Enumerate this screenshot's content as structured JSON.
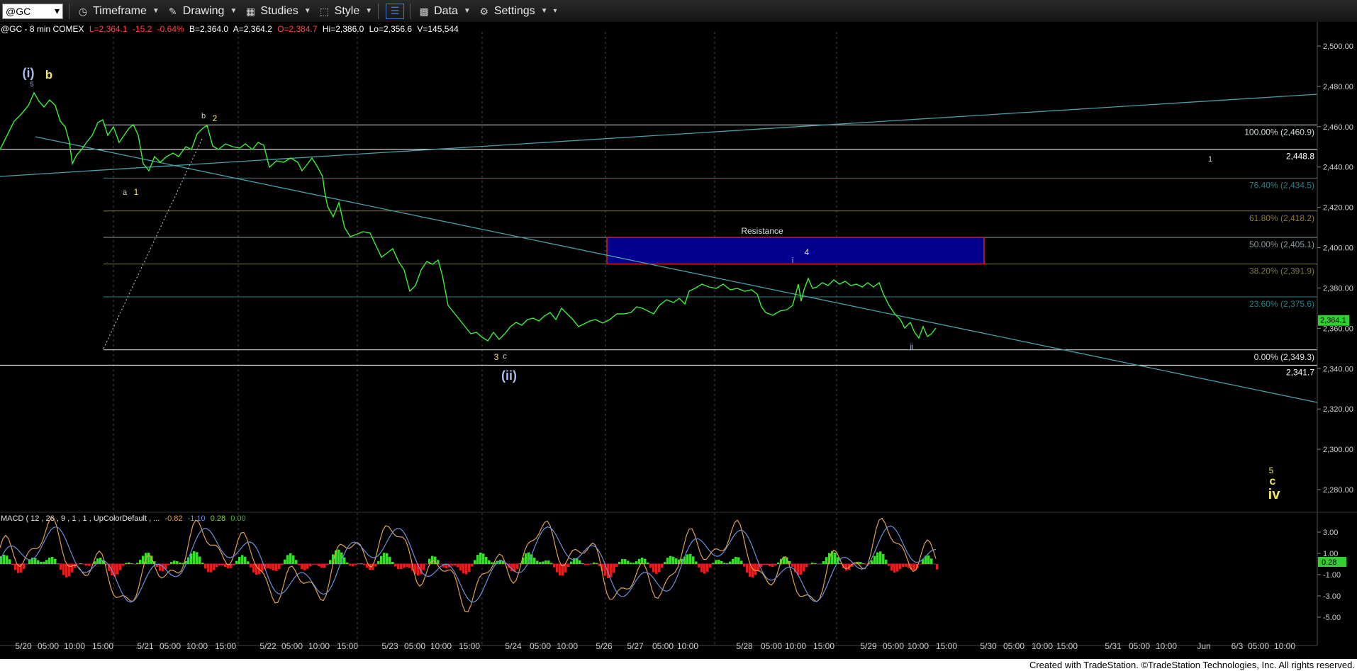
{
  "toolbar": {
    "symbol": "@GC",
    "timeframe": "Timeframe",
    "drawing": "Drawing",
    "studies": "Studies",
    "style": "Style",
    "data": "Data",
    "settings": "Settings"
  },
  "status_bar": {
    "symbol": "@GC - 8 min  COMEX",
    "last": "L=2,364.1",
    "change": "-15.2",
    "change_pct": "-0.64%",
    "bid": "B=2,364.0",
    "ask": "A=2,364.2",
    "open": "O=2,384.7",
    "high": "Hi=2,386.0",
    "low": "Lo=2,356.6",
    "volume": "V=145,544"
  },
  "price_axis": {
    "ticks": [
      "2,500.00",
      "2,480.00",
      "2,460.00",
      "2,440.00",
      "2,420.00",
      "2,400.00",
      "2,380.00",
      "2,360.00",
      "2,340.00",
      "2,320.00",
      "2,300.00",
      "2,280.00"
    ],
    "last_price": "2,364.1"
  },
  "time_axis": {
    "ticks": [
      "5/20",
      "05:00",
      "10:00",
      "15:00",
      "5/21",
      "05:00",
      "10:00",
      "15:00",
      "5/22",
      "05:00",
      "10:00",
      "15:00",
      "5/23",
      "05:00",
      "10:00",
      "15:00",
      "5/24",
      "05:00",
      "10:00",
      "5/26",
      "5/27",
      "05:00",
      "10:00",
      "5/28",
      "05:00",
      "10:00",
      "15:00",
      "5/29",
      "05:00",
      "10:00",
      "15:00",
      "5/30",
      "05:00",
      "10:00",
      "15:00",
      "5/31",
      "05:00",
      "10:00",
      "Jun",
      "6/3",
      "05:00",
      "10:00"
    ]
  },
  "fib_levels": [
    {
      "label": "100.00% (2,460.9)",
      "price": 2460.9,
      "color": "#cfd8d8"
    },
    {
      "label": "2,448.8",
      "price": 2448.8,
      "color": "#ffffff"
    },
    {
      "label": "76.40% (2,434.5)",
      "price": 2434.5,
      "color": "#2c7f86"
    },
    {
      "label": "61.80% (2,418.2)",
      "price": 2418.2,
      "color": "#8a7a30"
    },
    {
      "label": "50.00% (2,405.1)",
      "price": 2405.1,
      "color": "#8f9aa0"
    },
    {
      "label": "38.20% (2,391.9)",
      "price": 2391.9,
      "color": "#7c7a45"
    },
    {
      "label": "23.60% (2,375.6)",
      "price": 2375.6,
      "color": "#2c7f86"
    },
    {
      "label": "0.00% (2,349.3)",
      "price": 2349.3,
      "color": "#e0e0e0"
    },
    {
      "label": "2,341.7",
      "price": 2341.7,
      "color": "#ffffff"
    }
  ],
  "resistance": {
    "label": "Resistance",
    "top": 2405.1,
    "bottom": 2391.9
  },
  "wave_labels": [
    {
      "text": "(i)",
      "color": "#aabbe8"
    },
    {
      "text": "b",
      "color": "#f3e65a"
    },
    {
      "text": "5",
      "color": "#aabbe8"
    },
    {
      "text": "b",
      "color": "#cfcfcf"
    },
    {
      "text": "2",
      "color": "#f3e65a"
    },
    {
      "text": "a",
      "color": "#cfcfcf"
    },
    {
      "text": "1",
      "color": "#f3e65a"
    },
    {
      "text": "3",
      "color": "#f3e65a"
    },
    {
      "text": "c",
      "color": "#cfcfcf"
    },
    {
      "text": "(ii)",
      "color": "#aabbe8"
    },
    {
      "text": "4",
      "color": "#f3e65a"
    },
    {
      "text": "i",
      "color": "#aabbe8"
    },
    {
      "text": "ii",
      "color": "#aabbe8"
    },
    {
      "text": "1",
      "color": "#cfcfcf"
    },
    {
      "text": "5",
      "color": "#f3e65a"
    },
    {
      "text": "c",
      "color": "#f3e65a"
    },
    {
      "text": "iv",
      "color": "#f3e65a"
    }
  ],
  "macd": {
    "label": "MACD ( 12 , 26 , 9 , 1 , 1 , UpColorDefault , ...",
    "values": [
      "-0.82",
      "-1.10",
      "0.28",
      "0.00"
    ],
    "value_colors": [
      "#e0a050",
      "#6d8fd8",
      "#7bdc3a",
      "#3ab83a"
    ],
    "ticks": [
      "3.00",
      "1.00",
      "-1.00",
      "-3.00",
      "-5.00"
    ],
    "current": "0.28"
  },
  "footer": "Created with TradeStation. ©TradeStation Technologies, Inc. All rights reserved.",
  "colors": {
    "price_line": "#3df03a",
    "trendline": "#47a0aa",
    "resistance_fill": "#00008c",
    "resistance_border": "#d02020"
  }
}
